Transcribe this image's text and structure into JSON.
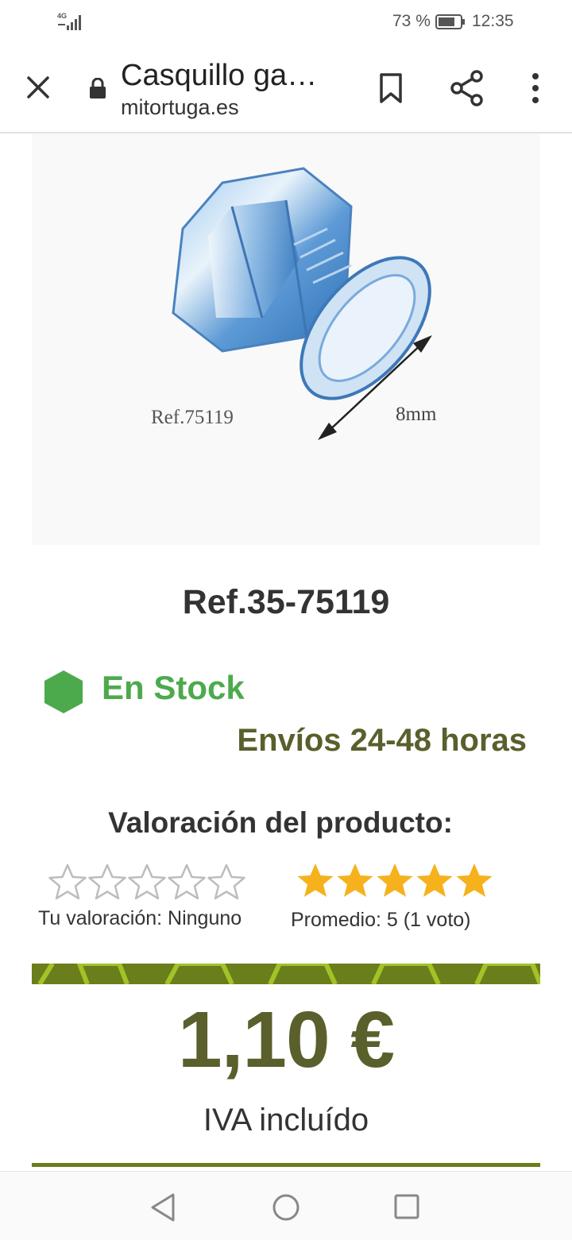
{
  "status_bar": {
    "network": "4G",
    "battery_percent": "73 %",
    "time": "12:35",
    "icons": [
      "signal-icon",
      "battery-icon"
    ]
  },
  "toolbar": {
    "title": "Casquillo ga…",
    "url": "mitortuga.es",
    "icons": [
      "close-icon",
      "lock-icon",
      "bookmark-icon",
      "share-icon",
      "more-vert-icon"
    ]
  },
  "product": {
    "image": {
      "ref_label": "Ref.75119",
      "dimension_label": "8mm"
    },
    "reference": "Ref.35-75119",
    "stock": {
      "label": "En Stock",
      "icon": "stock-hexagon-icon",
      "color": "#4caa4c"
    },
    "shipping": "Envíos 24-48 horas",
    "rating": {
      "title": "Valoración del producto:",
      "user_text": "Tu valoración: Ninguno",
      "user_stars": 0,
      "average_text": "Promedio: 5 (1 voto)",
      "average_stars": 5,
      "max_stars": 5,
      "star_color": "#f5b21d"
    },
    "price": {
      "amount": "1,10 €",
      "tax_note": "IVA incluído",
      "accent_color": "#6b7e1c"
    }
  },
  "navigation_bar": {
    "icons": [
      "back-icon",
      "home-icon",
      "recent-apps-icon"
    ]
  }
}
